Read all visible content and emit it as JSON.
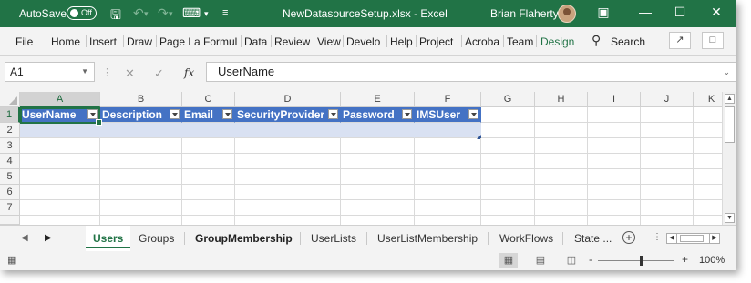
{
  "title_bar": {
    "autosave_label": "AutoSave",
    "autosave_state": "Off",
    "filename": "NewDatasourceSetup.xlsx  -  Excel",
    "user_name": "Brian Flaherty",
    "accent_color": "#217346"
  },
  "ribbon": {
    "tabs": [
      "File",
      "Home",
      "Insert",
      "Draw",
      "Page La",
      "Formul",
      "Data",
      "Review",
      "View",
      "Develo",
      "Help",
      "Project",
      "Acroba",
      "Team",
      "Design"
    ],
    "active_tab": "Design",
    "search_label": "Search"
  },
  "formula_bar": {
    "name_box": "A1",
    "fx_label": "fx",
    "formula_value": "UserName"
  },
  "grid": {
    "column_headers": [
      "A",
      "B",
      "C",
      "D",
      "E",
      "F",
      "G",
      "H",
      "I",
      "J",
      "K"
    ],
    "row_headers": [
      "1",
      "2",
      "3",
      "4",
      "5",
      "6",
      "7"
    ],
    "selected_column": "A",
    "selected_row": "1",
    "table_headers": [
      "UserName",
      "Description",
      "Email",
      "SecurityProvider",
      "Password",
      "IMSUser"
    ],
    "table_header_color": "#4472c4",
    "table_band_color": "#d9e1f2"
  },
  "sheet_tabs": {
    "tabs": [
      "Users",
      "Groups",
      "GroupMembership",
      "UserLists",
      "UserListMembership",
      "WorkFlows",
      "State ..."
    ],
    "active_tab": "Users"
  },
  "status_bar": {
    "zoom_level": "100%",
    "zoom_minus": "-",
    "zoom_plus": "+"
  }
}
